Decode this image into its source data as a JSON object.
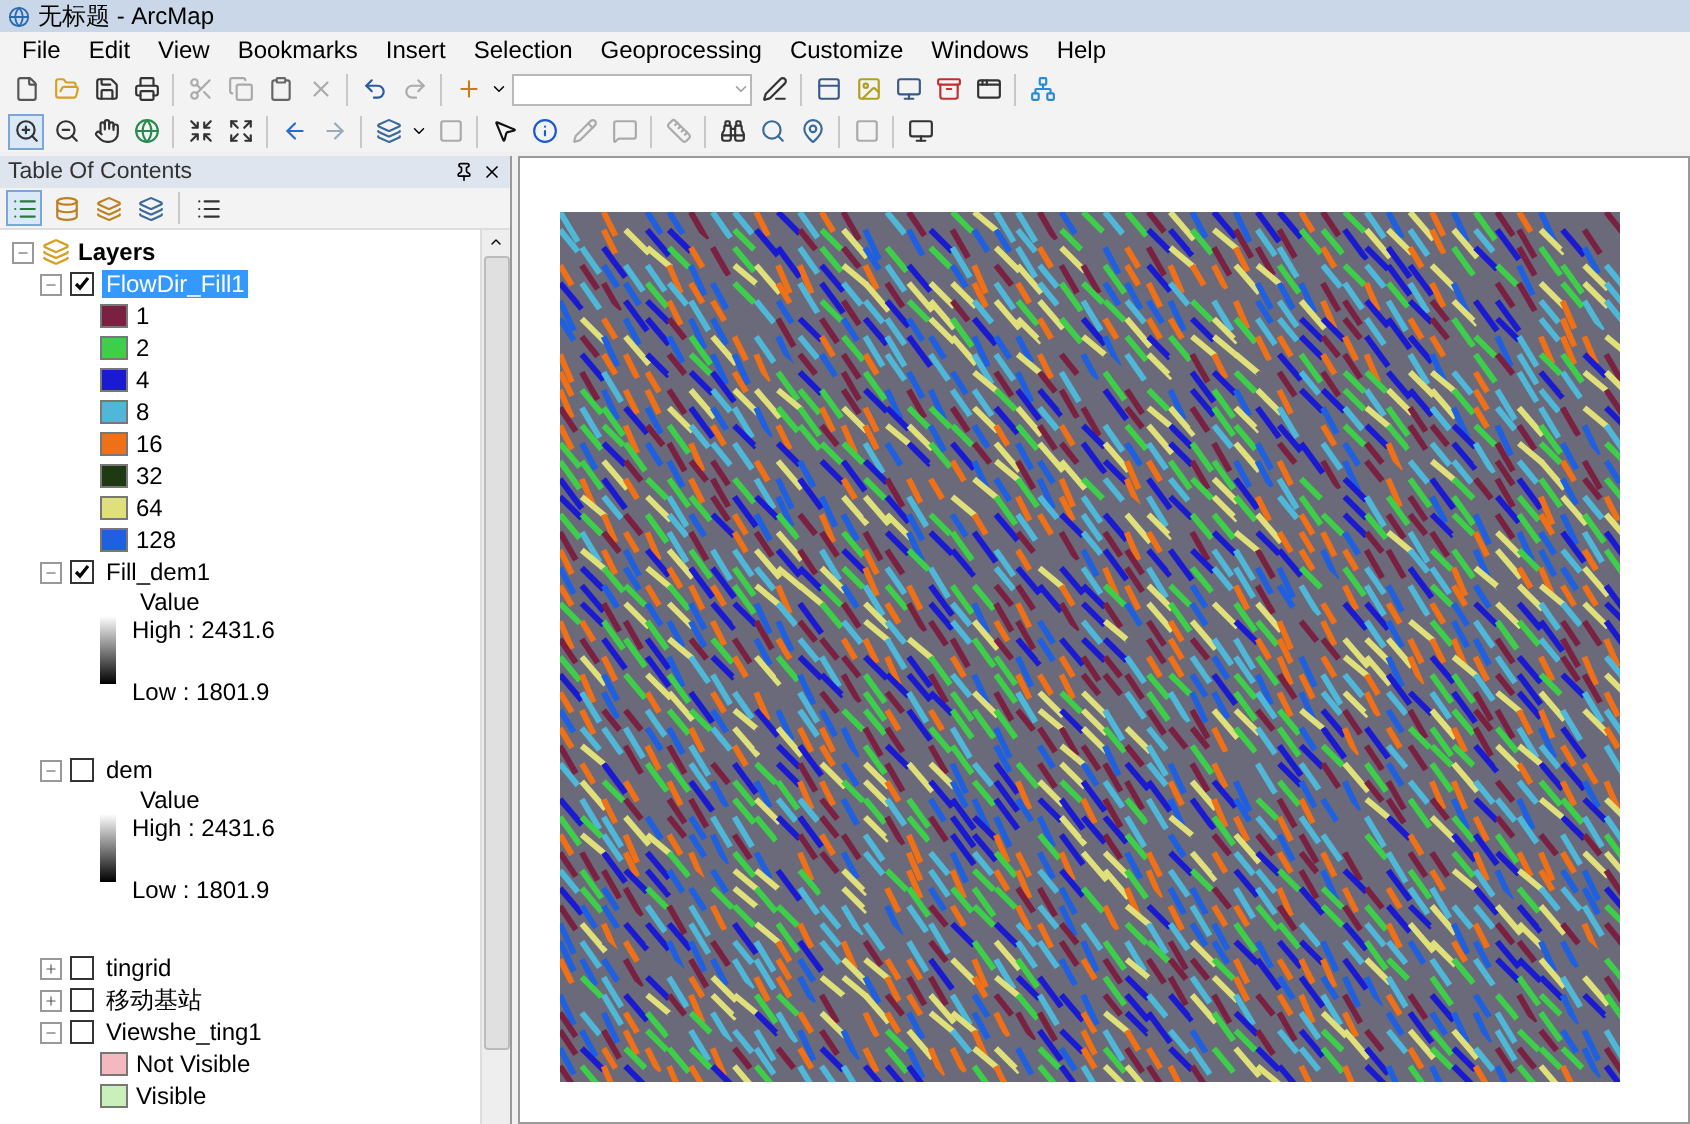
{
  "window": {
    "title": "无标题 - ArcMap"
  },
  "menu": [
    {
      "label": "File"
    },
    {
      "label": "Edit"
    },
    {
      "label": "View"
    },
    {
      "label": "Bookmarks"
    },
    {
      "label": "Insert"
    },
    {
      "label": "Selection"
    },
    {
      "label": "Geoprocessing"
    },
    {
      "label": "Customize"
    },
    {
      "label": "Windows"
    },
    {
      "label": "Help"
    }
  ],
  "toc": {
    "title": "Table Of Contents",
    "root": {
      "label": "Layers",
      "expanded": true,
      "children": [
        {
          "name": "FlowDir_Fill1",
          "checked": true,
          "expanded": true,
          "selected": true,
          "legend": [
            {
              "kind": "swatch",
              "label": "1",
              "color": "#7a2040"
            },
            {
              "kind": "swatch",
              "label": "2",
              "color": "#3ecf4a"
            },
            {
              "kind": "swatch",
              "label": "4",
              "color": "#1a1ad0"
            },
            {
              "kind": "swatch",
              "label": "8",
              "color": "#4fb8d8"
            },
            {
              "kind": "swatch",
              "label": "16",
              "color": "#f07018"
            },
            {
              "kind": "swatch",
              "label": "32",
              "color": "#1e3a12"
            },
            {
              "kind": "swatch",
              "label": "64",
              "color": "#e0e07a"
            },
            {
              "kind": "swatch",
              "label": "128",
              "color": "#1e60e0"
            }
          ]
        },
        {
          "name": "Fill_dem1",
          "checked": true,
          "expanded": true,
          "selected": false,
          "legend": [
            {
              "kind": "ramp",
              "heading": "Value",
              "high": "High : 2431.6",
              "low": "Low : 1801.9"
            }
          ]
        },
        {
          "name": "dem",
          "checked": false,
          "expanded": true,
          "selected": false,
          "legend": [
            {
              "kind": "ramp",
              "heading": "Value",
              "high": "High : 2431.6",
              "low": "Low : 1801.9"
            }
          ]
        },
        {
          "name": "tingrid",
          "checked": false,
          "expanded": false,
          "selected": false
        },
        {
          "name": "移动基站",
          "checked": false,
          "expanded": false,
          "selected": false
        },
        {
          "name": "Viewshe_ting1",
          "checked": false,
          "expanded": true,
          "selected": false,
          "legend": [
            {
              "kind": "swatch",
              "label": "Not Visible",
              "color": "#f4b8c0"
            },
            {
              "kind": "swatch",
              "label": "Visible",
              "color": "#c8f0b8"
            }
          ]
        }
      ]
    }
  }
}
